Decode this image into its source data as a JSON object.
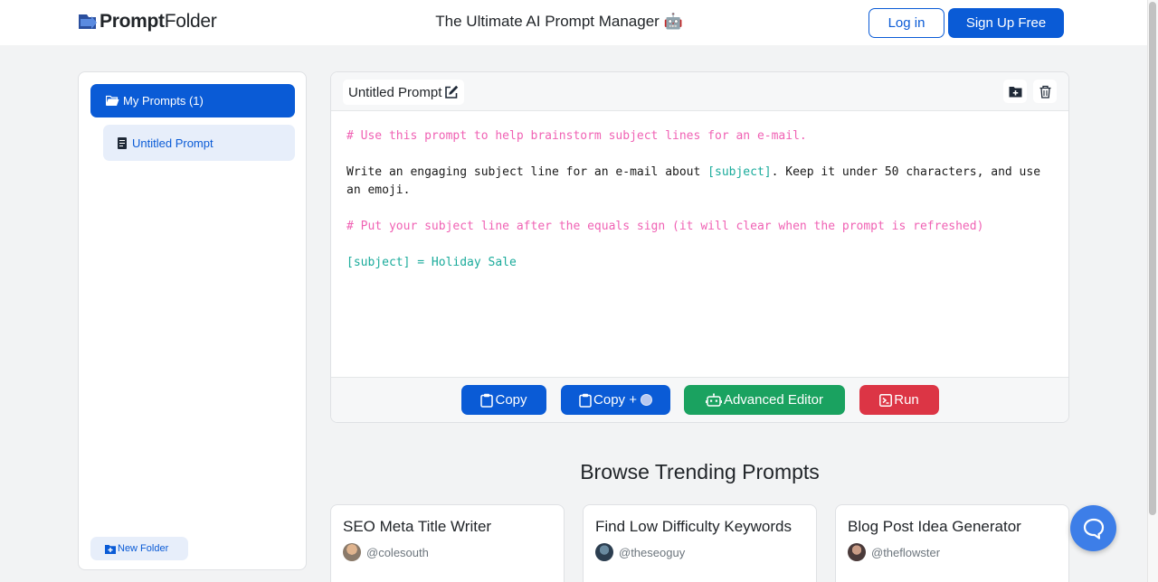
{
  "header": {
    "logo_bold": "Prompt",
    "logo_rest": "Folder",
    "tagline": "The Ultimate AI Prompt Manager 🤖",
    "login_label": "Log in",
    "signup_label": "Sign Up Free"
  },
  "sidebar": {
    "folder_label": "My Prompts (1)",
    "items": [
      {
        "label": "Untitled Prompt"
      }
    ],
    "new_folder_label": "New Folder"
  },
  "editor": {
    "title": "Untitled Prompt",
    "lines": {
      "l1": "# Use this prompt to help brainstorm subject lines for an e-mail.",
      "l2a": "Write an engaging subject line for an e-mail about ",
      "l2var": "[subject]",
      "l2b": ". Keep it under 50 characters, and use an emoji.",
      "l3": "# Put your subject line after the equals sign (it will clear when the prompt is refreshed)",
      "l4": "[subject] = Holiday Sale"
    },
    "actions": {
      "copy": "Copy",
      "copy_plus": "Copy +",
      "advanced": "Advanced Editor",
      "run": "Run"
    }
  },
  "trending": {
    "heading": "Browse Trending Prompts",
    "cards": [
      {
        "title": "SEO Meta Title Writer",
        "user": "@colesouth"
      },
      {
        "title": "Find Low Difficulty Keywords",
        "user": "@theseoguy"
      },
      {
        "title": "Blog Post Idea Generator",
        "user": "@theflowster"
      }
    ]
  },
  "colors": {
    "primary": "#0a5bd6",
    "success": "#1aa260",
    "danger": "#dc3545",
    "comment": "#f062b4",
    "variable": "#1aab9b"
  },
  "icons": [
    "logo-icon",
    "folder-open-icon",
    "document-icon",
    "edit-icon",
    "folder-plus-icon",
    "trash-icon",
    "clipboard-icon",
    "robot-icon",
    "terminal-icon",
    "chat-icon"
  ]
}
